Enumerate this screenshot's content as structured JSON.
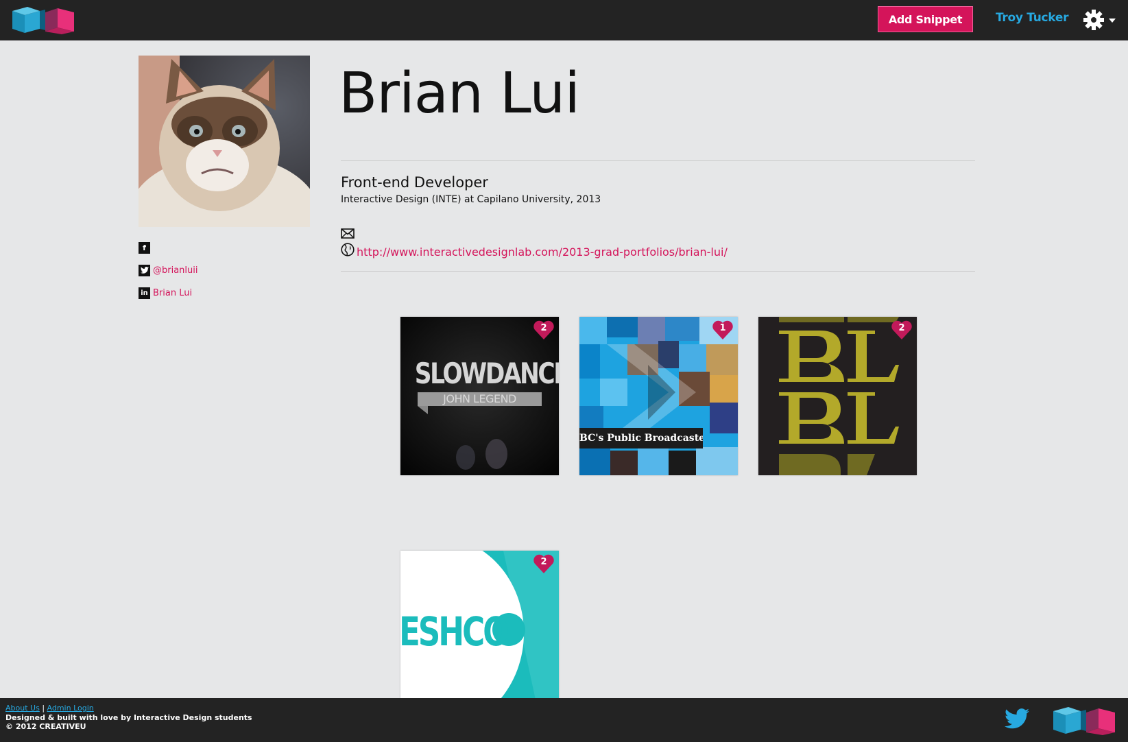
{
  "header": {
    "logo": "creativeu-logo",
    "add_snippet_label": "Add Snippet",
    "user_name": "Troy Tucker",
    "settings_icon": "gear-icon"
  },
  "profile": {
    "name": "Brian Lui",
    "title": "Front-end Developer",
    "program": "Interactive Design (INTE) at Capilano University, 2013",
    "website": "http://www.interactivedesignlab.com/2013-grad-portfolios/brian-lui/",
    "social": {
      "facebook_glyph": "f",
      "twitter_glyph": "t",
      "twitter_handle": "@brianluii",
      "linkedin_glyph": "in",
      "linkedin_name": "Brian Lui"
    }
  },
  "snippets": [
    {
      "likes": "2",
      "title": "SLOWDANCE",
      "subtitle": "JOHN LEGEND"
    },
    {
      "likes": "1",
      "caption": "BC's Public Broadcaster"
    },
    {
      "likes": "2"
    },
    {
      "likes": "2",
      "text": "ESHCO"
    }
  ],
  "footer": {
    "about_label": "About Us",
    "separator": "|",
    "admin_label": "Admin Login",
    "tagline": "Designed & built with love by Interactive Design students",
    "copyright": "© 2012 CREATIVEU"
  },
  "colors": {
    "accent_pink": "#d4145a",
    "accent_blue": "#27a9e1",
    "bar_dark": "#232323",
    "page_bg": "#e6e7e8"
  }
}
